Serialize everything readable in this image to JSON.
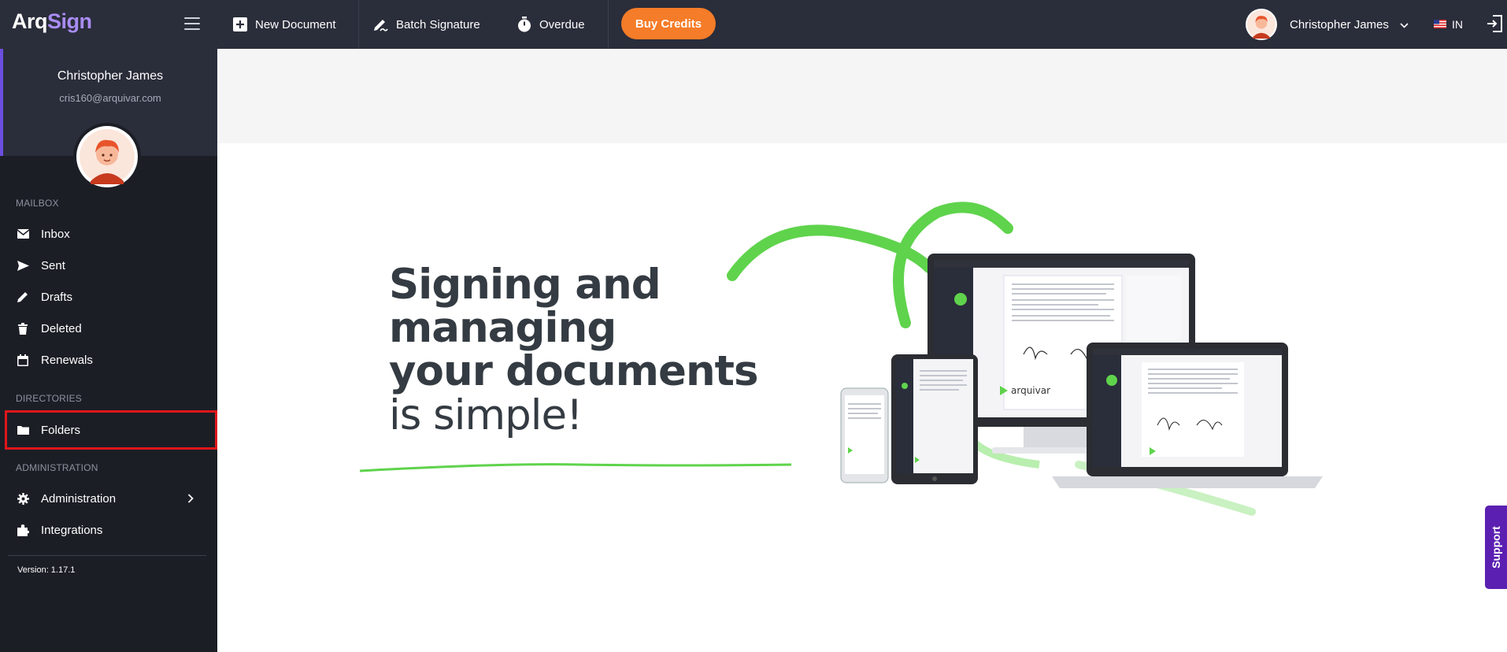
{
  "app": {
    "logo_part1": "Arq",
    "logo_part2": "Sign"
  },
  "user": {
    "name": "Christopher James",
    "email": "cris160@arquivar.com"
  },
  "topbar": {
    "new_document": "New Document",
    "batch_signature": "Batch Signature",
    "overdue": "Overdue",
    "buy_credits": "Buy Credits",
    "user_name": "Christopher James",
    "language": "IN"
  },
  "sidebar": {
    "mailbox_section": "MAILBOX",
    "directories_section": "DIRECTORIES",
    "administration_section": "ADMINISTRATION",
    "inbox": "Inbox",
    "sent": "Sent",
    "drafts": "Drafts",
    "deleted": "Deleted",
    "renewals": "Renewals",
    "folders": "Folders",
    "administration": "Administration",
    "integrations": "Integrations",
    "version": "Version: 1.17.1"
  },
  "hero": {
    "line1": "Signing and",
    "line2": "managing",
    "line3": "your documents",
    "line4": "is simple!"
  },
  "mockup": {
    "brand": "arquivar"
  },
  "support": {
    "label": "Support"
  },
  "colors": {
    "accent": "#f57c28",
    "purple": "#6c4ee0",
    "green": "#5fd34c",
    "highlight": "#e0161b"
  }
}
